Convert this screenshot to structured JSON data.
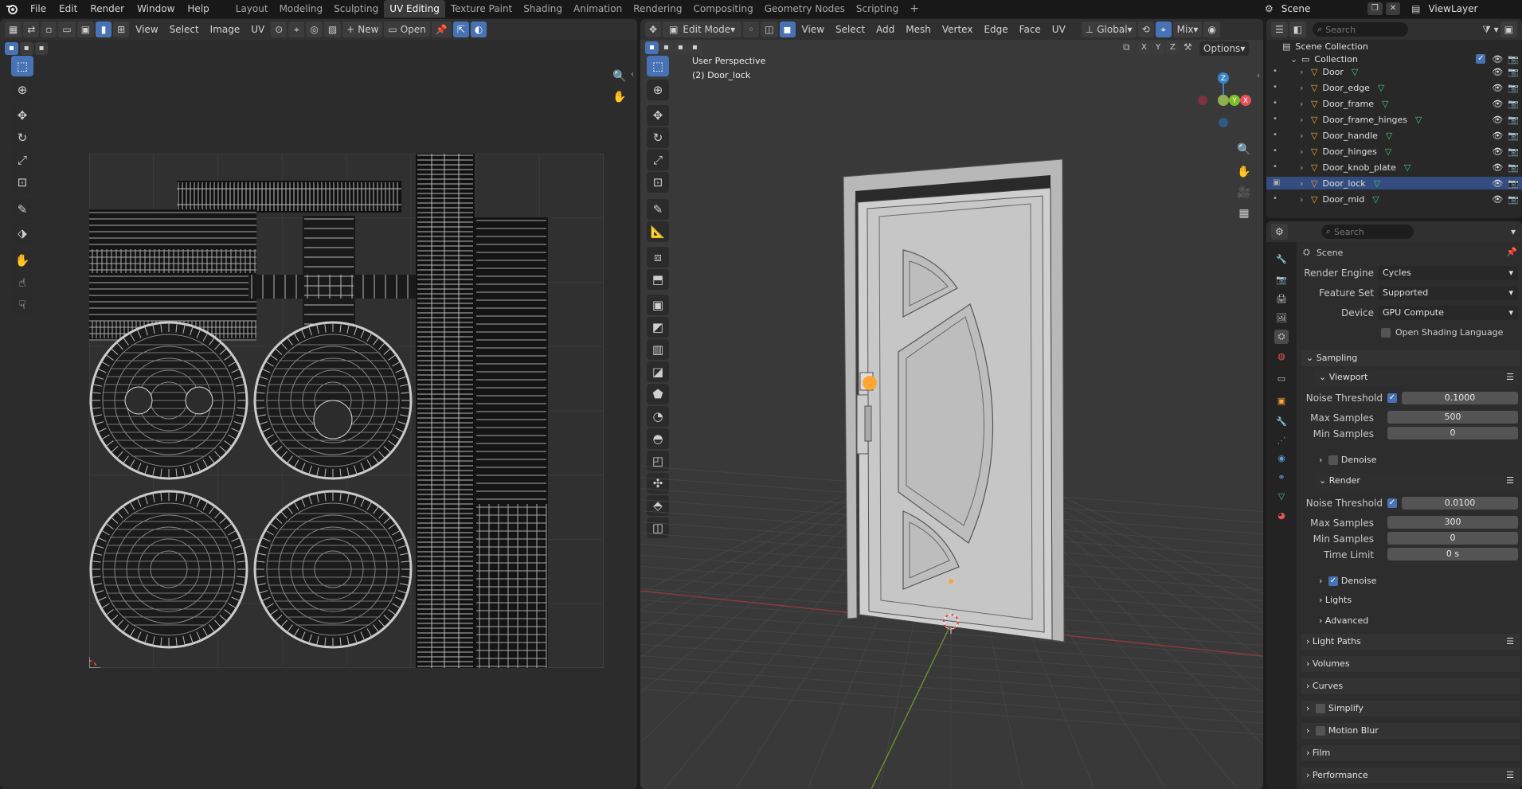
{
  "topbar": {
    "menus": [
      "File",
      "Edit",
      "Render",
      "Window",
      "Help"
    ],
    "workspaces": [
      "Layout",
      "Modeling",
      "Sculpting",
      "UV Editing",
      "Texture Paint",
      "Shading",
      "Animation",
      "Rendering",
      "Compositing",
      "Geometry Nodes",
      "Scripting"
    ],
    "active_workspace": "UV Editing",
    "scene_name": "Scene",
    "view_layer": "ViewLayer"
  },
  "uv_editor": {
    "menus": [
      "View",
      "Select",
      "Image",
      "UV"
    ],
    "new_label": "New",
    "open_label": "Open"
  },
  "viewport": {
    "mode": "Edit Mode",
    "menus": [
      "View",
      "Select",
      "Add",
      "Mesh",
      "Vertex",
      "Edge",
      "Face",
      "UV"
    ],
    "transform_orientation": "Global",
    "shading_mix": "Mix",
    "axes": [
      "X",
      "Y",
      "Z"
    ],
    "options_label": "Options",
    "overlay_title": "User Perspective",
    "overlay_object": "(2) Door_lock",
    "gizmo_labels": {
      "x": "X",
      "y": "Y",
      "z": "Z"
    }
  },
  "outliner": {
    "search_placeholder": "Search",
    "root": "Scene Collection",
    "collection": "Collection",
    "items": [
      "Door",
      "Door_edge",
      "Door_frame",
      "Door_frame_hinges",
      "Door_handle",
      "Door_hinges",
      "Door_knob_plate",
      "Door_lock",
      "Door_mid"
    ],
    "selected": "Door_lock"
  },
  "properties": {
    "search_placeholder": "Search",
    "context": "Scene",
    "render_engine_label": "Render Engine",
    "render_engine": "Cycles",
    "feature_set_label": "Feature Set",
    "feature_set": "Supported",
    "device_label": "Device",
    "device": "GPU Compute",
    "osl_label": "Open Shading Language",
    "sampling": "Sampling",
    "viewport": "Viewport",
    "vp_noise_label": "Noise Threshold",
    "vp_noise": "0.1000",
    "vp_max_label": "Max Samples",
    "vp_max": "500",
    "vp_min_label": "Min Samples",
    "vp_min": "0",
    "vp_denoise": "Denoise",
    "render": "Render",
    "r_noise_label": "Noise Threshold",
    "r_noise": "0.0100",
    "r_max_label": "Max Samples",
    "r_max": "300",
    "r_min_label": "Min Samples",
    "r_min": "0",
    "r_time_label": "Time Limit",
    "r_time": "0 s",
    "r_denoise": "Denoise",
    "lights": "Lights",
    "advanced": "Advanced",
    "light_paths": "Light Paths",
    "volumes": "Volumes",
    "curves": "Curves",
    "simplify": "Simplify",
    "motion_blur": "Motion Blur",
    "film": "Film",
    "performance": "Performance"
  },
  "colors": {
    "accent": "#4772b3",
    "selected_row": "#334d80",
    "object_origin": "#ffa533",
    "axis_x": "#e5505a",
    "axis_y": "#7bbf26",
    "axis_z": "#3b86c6"
  }
}
